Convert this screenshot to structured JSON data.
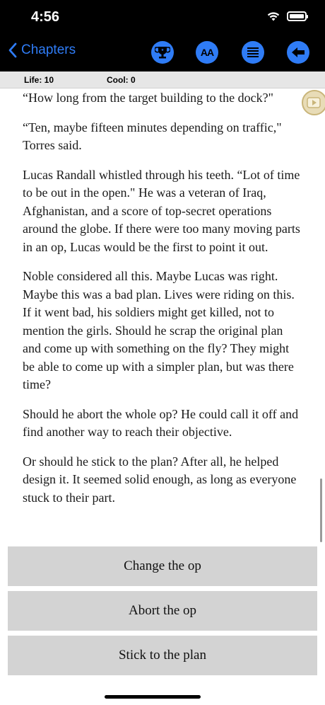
{
  "status": {
    "time": "4:56"
  },
  "nav": {
    "back_label": "Chapters",
    "icons": [
      "trophy-icon",
      "font-size-icon",
      "menu-icon",
      "back-arrow-icon"
    ],
    "accent_color": "#2f7cf6",
    "font_button_text": "AA"
  },
  "stats": {
    "life": "Life: 10",
    "cool": "Cool: 0"
  },
  "story": {
    "paragraphs": [
      "“How long from the target building to the dock?\"",
      "“Ten, maybe fifteen minutes depending on traffic,\" Torres said.",
      "Lucas Randall whistled through his teeth. “Lot of time to be out in the open.\" He was a veteran of Iraq, Afghanistan, and a score of top-secret operations around the globe. If there were too many moving parts in an op, Lucas would be the first to point it out.",
      "Noble considered all this. Maybe Lucas was right. Maybe this was a bad plan. Lives were riding on this. If it went bad, his soldiers might get killed, not to mention the girls. Should he scrap the original plan and come up with something on the fly? They might be able to come up with a simpler plan, but was there time?",
      "Should he abort the whole op? He could call it off and find another way to reach their objective.",
      "Or should he stick to the plan? After all, he helped design it. It seemed solid enough, as long as everyone stuck to their part."
    ]
  },
  "choices": [
    "Change the op",
    "Abort the op",
    "Stick to the plan"
  ]
}
